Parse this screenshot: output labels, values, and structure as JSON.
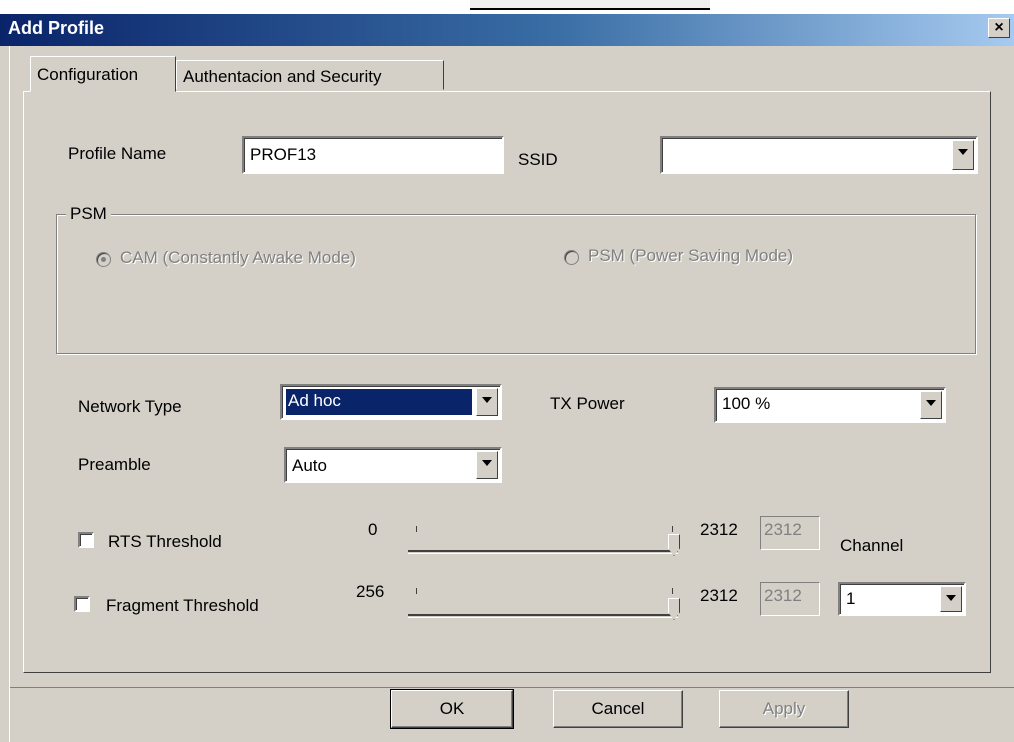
{
  "window": {
    "title": "Add Profile",
    "close_label": "×"
  },
  "tabs": [
    {
      "label": "Configuration",
      "active": true
    },
    {
      "label": "Authentacion and Security",
      "active": false
    }
  ],
  "profile": {
    "label": "Profile Name",
    "value": "PROF13"
  },
  "ssid": {
    "label": "SSID",
    "value": ""
  },
  "psm_group": {
    "label": "PSM",
    "options": [
      {
        "label": "CAM (Constantly Awake Mode)",
        "checked": true,
        "enabled": false
      },
      {
        "label": "PSM (Power Saving Mode)",
        "checked": false,
        "enabled": false
      }
    ]
  },
  "network_type": {
    "label": "Network Type",
    "value": "Ad hoc"
  },
  "tx_power": {
    "label": "TX Power",
    "value": "100 %"
  },
  "preamble": {
    "label": "Preamble",
    "value": "Auto"
  },
  "rts": {
    "label": "RTS Threshold",
    "checked": false,
    "min": "0",
    "max": "2312",
    "value": "2312"
  },
  "fragment": {
    "label": "Fragment Threshold",
    "checked": false,
    "min": "256",
    "max": "2312",
    "value": "2312"
  },
  "channel": {
    "label": "Channel",
    "value": "1"
  },
  "buttons": {
    "ok": "OK",
    "cancel": "Cancel",
    "apply": "Apply"
  },
  "colors": {
    "title_bar": "#0a246a",
    "selection": "#0a246a",
    "face": "#d4d0c8"
  }
}
